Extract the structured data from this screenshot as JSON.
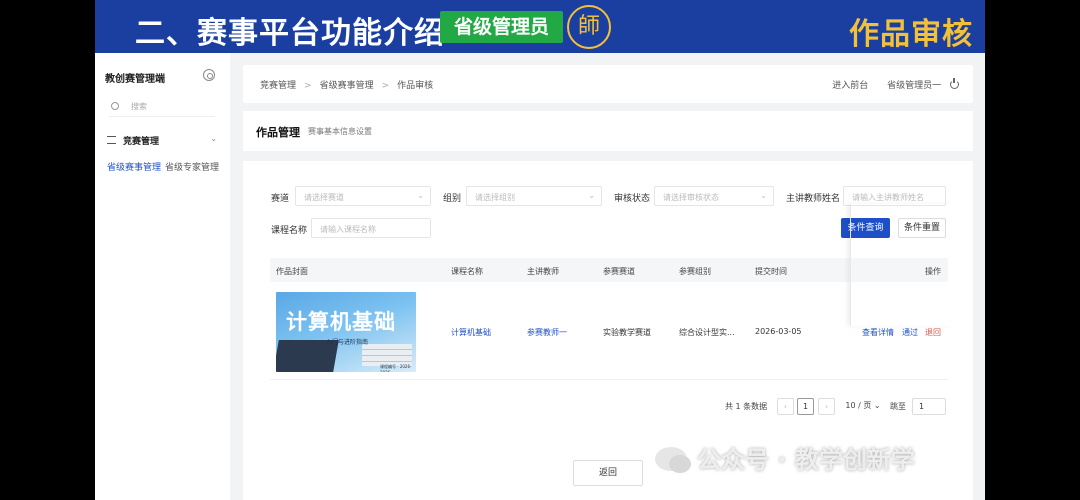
{
  "banner": {
    "title": "二、赛事平台功能介绍",
    "badge": "省级管理员",
    "logo_glyph": "師",
    "right_title": "作品审核",
    "colors": {
      "background": "#1a3fa0",
      "badge": "#22a845",
      "accent": "#f3c03a"
    }
  },
  "sidebar": {
    "title": "教创赛管理端",
    "search_placeholder": "搜索",
    "group_label": "竞赛管理",
    "sub_items": [
      {
        "label": "省级赛事管理",
        "active": true
      },
      {
        "label": "省级专家管理",
        "active": false
      }
    ]
  },
  "header": {
    "breadcrumb": [
      "竞赛管理",
      "省级赛事管理",
      "作品审核"
    ],
    "enter_front": "进入前台",
    "user": "省级管理员一"
  },
  "page": {
    "title": "作品管理",
    "subtitle": "赛事基本信息设置"
  },
  "filters": {
    "track_label": "赛道",
    "track_placeholder": "请选择赛道",
    "group_label": "组别",
    "group_placeholder": "请选择组别",
    "status_label": "审核状态",
    "status_placeholder": "请选择审核状态",
    "teacher_label": "主讲教师姓名",
    "teacher_placeholder": "请输入主讲教师姓名",
    "course_label": "课程名称",
    "course_placeholder": "请输入课程名称",
    "search_button": "条件查询",
    "reset_button": "条件重置"
  },
  "table": {
    "headers": [
      "作品封面",
      "课程名称",
      "主讲教师",
      "参赛赛道",
      "参赛组别",
      "提交时间",
      "操作"
    ],
    "rows": [
      {
        "cover": {
          "title": "计算机基础",
          "subtitle": "入门与进阶指南",
          "footer": "课程编号 · 2026-2026"
        },
        "course": "计算机基础",
        "teacher": "参赛教师一",
        "track": "实验教学赛道",
        "group": "综合设计型实...",
        "submitted": "2026-03-05",
        "actions": [
          "查看详情",
          "通过",
          "退回"
        ]
      }
    ]
  },
  "pagination": {
    "total": "共 1 条数据",
    "current_page": "1",
    "page_size": "10 / 页",
    "jump_label": "跳至",
    "jump_value": "1"
  },
  "footer": {
    "back_button": "返回"
  },
  "watermark": {
    "text": "公众号 · 教学创新学"
  }
}
